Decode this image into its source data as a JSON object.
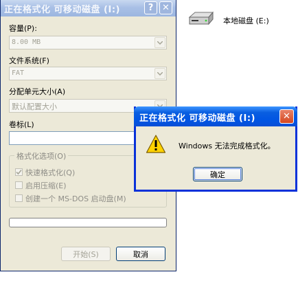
{
  "format_dialog": {
    "title": "正在格式化 可移动磁盘 (I:)",
    "help_button": "?",
    "close_button": "✕",
    "capacity_label": "容量(P):",
    "capacity_value": "8.00 MB",
    "filesystem_label": "文件系统(F)",
    "filesystem_value": "FAT",
    "allocation_label": "分配单元大小(A)",
    "allocation_value": "默认配置大小",
    "volume_label": "卷标(L)",
    "volume_value": "",
    "options_group_title": "格式化选项(O)",
    "options": [
      {
        "label": "快速格式化(Q)",
        "checked": true
      },
      {
        "label": "启用压缩(E)",
        "checked": false
      },
      {
        "label": "创建一个 MS-DOS 启动盘(M)",
        "checked": false
      }
    ],
    "progress": 0,
    "start_button": "开始(S)",
    "cancel_button": "取消"
  },
  "error_dialog": {
    "title": "正在格式化 可移动磁盘 (I:)",
    "close_button": "✕",
    "message": "Windows 无法完成格式化。",
    "ok_button": "确定",
    "icon": "warning-icon"
  },
  "desktop": {
    "drive_label": "本地磁盘 (E:)",
    "drive_icon": "hard-drive-icon"
  },
  "colors": {
    "dialog_bg": "#ece9d8",
    "active_title": "#0054e3",
    "inactive_title": "#9cb6e0",
    "warning_yellow": "#ffd200"
  }
}
